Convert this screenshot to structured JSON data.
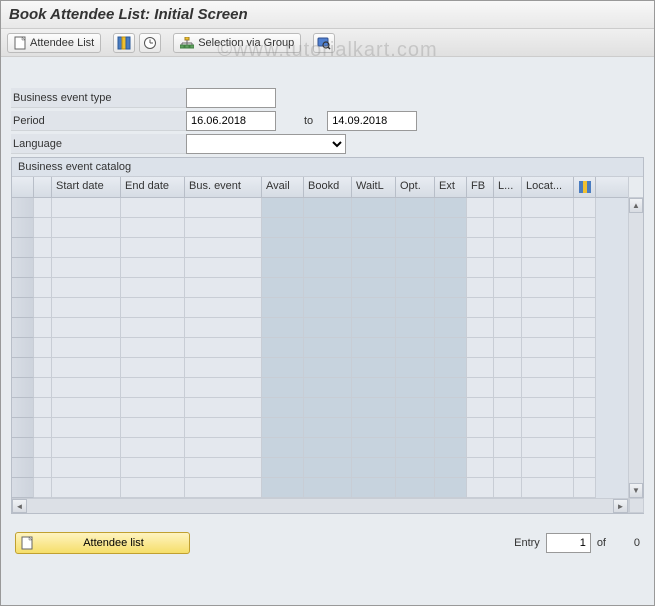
{
  "title": "Book Attendee List: Initial Screen",
  "toolbar": {
    "attendee_list": "Attendee List",
    "selection_via_group": "Selection via Group"
  },
  "form": {
    "business_event_type_label": "Business event type",
    "business_event_type_value": "",
    "period_label": "Period",
    "period_from": "16.06.2018",
    "period_to_label": "to",
    "period_to": "14.09.2018",
    "language_label": "Language",
    "language_value": ""
  },
  "catalog": {
    "title": "Business event catalog",
    "columns": [
      "",
      "",
      "Start date",
      "End date",
      "Bus. event",
      "Avail",
      "Bookd",
      "WaitL",
      "Opt.",
      "Ext",
      "FB",
      "L...",
      "Locat..."
    ]
  },
  "footer": {
    "attendee_list_button": "Attendee list",
    "entry_label": "Entry",
    "entry_value": "1",
    "of_label": "of",
    "entry_total": "0"
  },
  "watermark": "©www.tutorialkart.com"
}
